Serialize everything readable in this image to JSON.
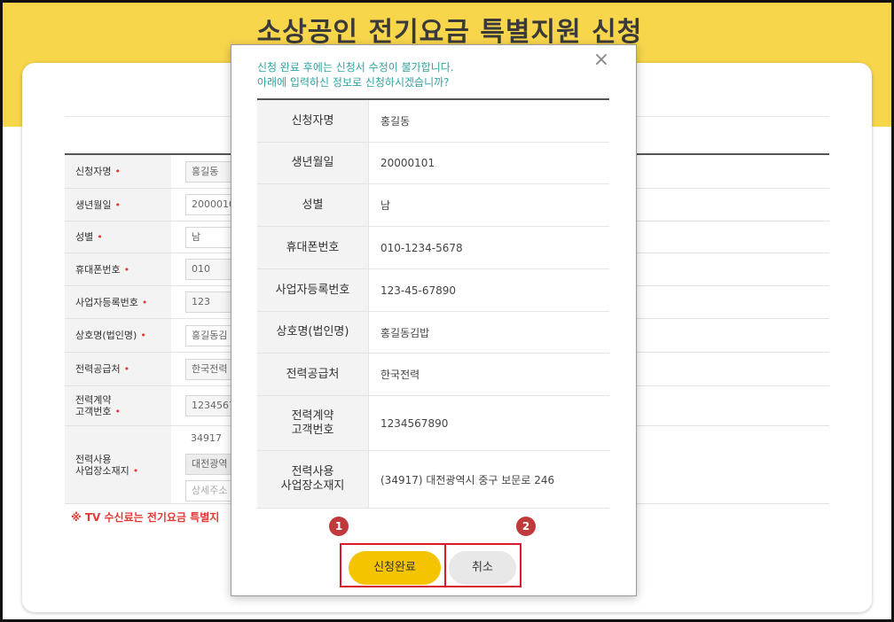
{
  "page": {
    "title": "소상공인 전기요금 특별지원 신청"
  },
  "form": {
    "rows": [
      {
        "label": "신청자명",
        "required": "•",
        "value": "홍길동"
      },
      {
        "label": "생년월일",
        "required": "•",
        "value": "2000010"
      },
      {
        "label": "성별",
        "required": "•",
        "value": "남"
      },
      {
        "label": "휴대폰번호",
        "required": "•",
        "value": "010"
      },
      {
        "label": "사업자등록번호",
        "required": "•",
        "value": "123"
      },
      {
        "label": "상호명(법인명)",
        "required": "•",
        "value": "홍길동김"
      },
      {
        "label": "전력공급처",
        "required": "•",
        "value": "한국전력"
      },
      {
        "label_line1": "전력계약",
        "label_line2": "고객번호",
        "required": "•",
        "value": "1234567"
      },
      {
        "label_line1": "전력사용",
        "label_line2": "사업장소재지",
        "required": "•",
        "postcode": "34917",
        "address": "대전광역",
        "detail_placeholder": "상세주소"
      }
    ],
    "notice": "※ TV 수신료는 전기요금 특별지"
  },
  "modal": {
    "message_line1": "신청 완료 후에는 신청서 수정이 불가합니다.",
    "message_line2": "아래에 입력하신 정보로 신청하시겠습니까?",
    "close_icon": "×",
    "rows": [
      {
        "label": "신청자명",
        "value": "홍길동"
      },
      {
        "label": "생년월일",
        "value": "20000101"
      },
      {
        "label": "성별",
        "value": "남"
      },
      {
        "label": "휴대폰번호",
        "value": "010-1234-5678"
      },
      {
        "label": "사업자등록번호",
        "value": "123-45-67890"
      },
      {
        "label": "상호명(법인명)",
        "value": "홍길동김밥"
      },
      {
        "label": "전력공급처",
        "value": "한국전력"
      },
      {
        "label_line1": "전력계약",
        "label_line2": "고객번호",
        "value": "1234567890"
      },
      {
        "label_line1": "전력사용",
        "label_line2": "사업장소재지",
        "value": "(34917) 대전광역시 중구 보문로 246"
      }
    ],
    "confirm_label": "신청완료",
    "cancel_label": "취소",
    "badge1": "1",
    "badge2": "2"
  }
}
